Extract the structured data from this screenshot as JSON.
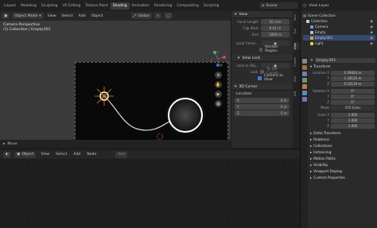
{
  "top": {
    "tabs": [
      "Layout",
      "Modeling",
      "Sculpting",
      "UV Editing",
      "Texture Paint",
      "Shading",
      "Animation",
      "Rendering",
      "Compositing",
      "Scripting"
    ],
    "active_tab": "Shading",
    "scene_label": "Scene",
    "view_layer_label": "View Layer"
  },
  "viewport": {
    "mode": "Object Mode",
    "menu": [
      "View",
      "Select",
      "Add",
      "Object"
    ],
    "orientation": "Global",
    "info_line1": "Camera Perspective",
    "info_line2": "(1) Collection | Empty.001"
  },
  "npanel": {
    "view_header": "View",
    "focal_length_label": "Focal Length",
    "focal_length_value": "50 mm",
    "clip_start_label": "Clip Start",
    "clip_start_value": "0.01 m",
    "clip_end_label": "End",
    "clip_end_value": "1000 m",
    "local_camera_label": "Local Came...",
    "render_region_label": "Render Region",
    "view_lock_header": "View Lock",
    "lock_to_obj_label": "Lock to Obj...",
    "lock_label": "Lock",
    "to_3d_cursor_label": "To 3D Cursor",
    "camera_to_view_label": "Camera to View",
    "cursor_header": "3D Cursor",
    "location_label": "Location",
    "x_label": "X",
    "x_value": "0 m",
    "y_label": "Y",
    "y_value": "0 m",
    "z_label": "Z",
    "z_value": "0 m",
    "tabs": [
      "Item",
      "Tool",
      "View",
      "Create",
      "Edit",
      "ANT"
    ]
  },
  "timeline": {
    "label": "Move"
  },
  "editor2": {
    "mode": "Object",
    "menu": [
      "View",
      "Select",
      "Add",
      "Node"
    ],
    "slot": "Slot"
  },
  "outliner": {
    "header": "Scene Collection",
    "items": [
      {
        "label": "Collection",
        "color": "#d0d0d0",
        "indent": 0,
        "selected": false
      },
      {
        "label": "Camera",
        "color": "#6aa0d8",
        "indent": 1,
        "selected": false
      },
      {
        "label": "Empty",
        "color": "#c0c0c0",
        "indent": 1,
        "selected": false
      },
      {
        "label": "Empty.001",
        "color": "#e0a040",
        "indent": 1,
        "selected": true
      },
      {
        "label": "Light",
        "color": "#e0d060",
        "indent": 1,
        "selected": false
      }
    ]
  },
  "properties": {
    "object_name": "Empty.001",
    "transform_header": "Transform",
    "location_label": "Location X",
    "loc": [
      "0.39063 m",
      "1.18126 m",
      "0.10119 m"
    ],
    "rotation_label": "Rotation X",
    "rot": [
      "0°",
      "0°",
      "0°"
    ],
    "mode_label": "Mode",
    "mode_value": "XYZ Euler",
    "scale_label": "Scale X",
    "scale": [
      "1.000",
      "1.000",
      "1.000"
    ],
    "axis_y": "Y",
    "axis_z": "Z",
    "sections": [
      "Delta Transform",
      "Relations",
      "Collections",
      "Instancing",
      "Motion Paths",
      "Visibility",
      "Viewport Display",
      "Custom Properties"
    ]
  }
}
